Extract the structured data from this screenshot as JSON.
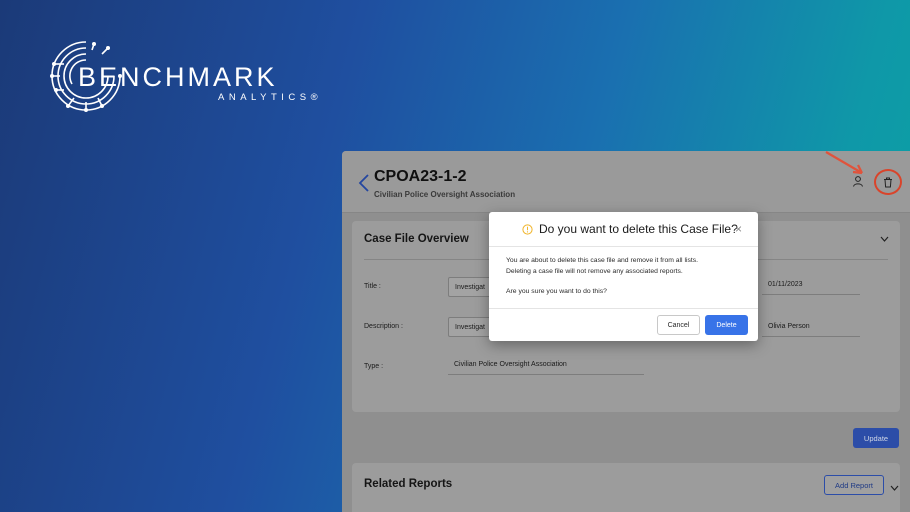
{
  "brand": {
    "name": "BENCHMARK",
    "sub": "ANALYTICS®"
  },
  "header": {
    "case_id": "CPOA23-1-2",
    "organization": "Civilian Police Oversight Association",
    "user_icon": "user-icon",
    "trash_icon": "trash-icon"
  },
  "overview": {
    "title": "Case File Overview",
    "fields": [
      {
        "label": "Title :",
        "value": "Investigat"
      },
      {
        "label": "Description :",
        "value": "Investigat"
      },
      {
        "label": "Type :",
        "value": "Civilian Police Oversight Association"
      }
    ],
    "right_fields": [
      "01/11/2023",
      "Olivia Person"
    ]
  },
  "actions": {
    "update": "Update"
  },
  "related": {
    "title": "Related Reports",
    "add_button": "Add Report"
  },
  "modal": {
    "title": "Do you want to delete this Case File?",
    "close": "×",
    "line1": "You are about to delete this case file and remove it from all lists.",
    "line2": "Deleting a case file will not remove any associated reports.",
    "question": "Are you sure you want to do this?",
    "cancel": "Cancel",
    "delete": "Delete"
  },
  "colors": {
    "primary": "#3873e8",
    "highlight": "#d9442b",
    "warning": "#f0b429"
  }
}
